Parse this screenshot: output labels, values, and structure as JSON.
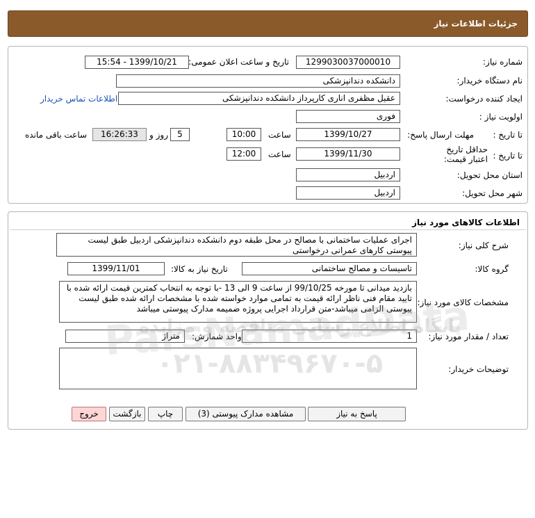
{
  "header": {
    "title": "جزئیات اطلاعات نیاز"
  },
  "details": {
    "need_number_label": "شماره نیاز:",
    "need_number": "1299030037000010",
    "announce_label": "تاریخ و ساعت اعلان عمومی:",
    "announce_value": "1399/10/21 - 15:54",
    "buyer_org_label": "نام دستگاه خریدار:",
    "buyer_org": "دانشکده دندانپزشکی",
    "creator_label": "ایجاد کننده درخواست:",
    "creator": "عقیل مظفری اناری کارپرداز دانشکده دندانپزشکی",
    "contact_link": "اطلاعات تماس خریدار",
    "priority_label": "اولویت نیاز :",
    "priority": "فوری",
    "deadline_label": "مهلت ارسال پاسخ:",
    "deadline_to_label": "تا تاریخ :",
    "deadline_date": "1399/10/27",
    "deadline_time_label": "ساعت",
    "deadline_time": "10:00",
    "days_value": "5",
    "days_label": "روز و",
    "remaining_time": "16:26:33",
    "remaining_label": "ساعت باقی مانده",
    "validity_label": "حداقل تاریخ اعتبار قیمت:",
    "validity_to_label": "تا تاریخ :",
    "validity_date": "1399/11/30",
    "validity_time_label": "ساعت",
    "validity_time": "12:00",
    "province_label": "استان محل تحویل:",
    "province": "اردبیل",
    "city_label": "شهر محل تحویل:",
    "city": "اردبیل"
  },
  "goods": {
    "section_title": "اطلاعات کالاهای مورد نیاز",
    "general_desc_label": "شرح کلی نیاز:",
    "general_desc": "اجرای عملیات ساختمانی  با مصالح  در محل طبقه دوم دانشکده دندانپزشکی اردبیل طبق لیست پیوستی کارهای عمرانی  درخواستی",
    "group_label": "گروه کالا:",
    "group_value": "تاسیسات و مصالح ساختمانی",
    "need_date_label": "تاریخ نیاز به کالا:",
    "need_date": "1399/11/01",
    "specs_label": "مشخصات کالای مورد نیاز:",
    "specs": "بازدید میدانی تا مورخه 99/10/25 از ساعت 9 الی 13 -با توجه به انتخاب کمترین قیمت ارائه شده با تایید مقام فنی ناظر ارائه قیمت به تمامی موارد خواسته شده با مشخصات ارائه شده طبق لیست پیوستی الزامی میباشد-متن قرارداد اجرایی پروژه ضمیمه مدارک پیوستی میباشد",
    "qty_label": "تعداد / مقدار مورد نیاز:",
    "qty": "1",
    "unit_label": "واحد شمارش:",
    "unit": "متراژ",
    "buyer_notes_label": "توضیحات خریدار:",
    "buyer_notes": ""
  },
  "buttons": {
    "reply": "پاسخ به نیاز",
    "view_docs": "مشاهده مدارک پیوستی (3)",
    "print": "چاپ",
    "back": "بازگشت",
    "exit": "خروج"
  },
  "watermark": {
    "line1": "پایگاه اطلاع رسانی مناقصه و مزایده",
    "line2": "۰۲۱-۸۸۳۴۹۶۷۰-۵",
    "brand": "ParsNamadData"
  }
}
